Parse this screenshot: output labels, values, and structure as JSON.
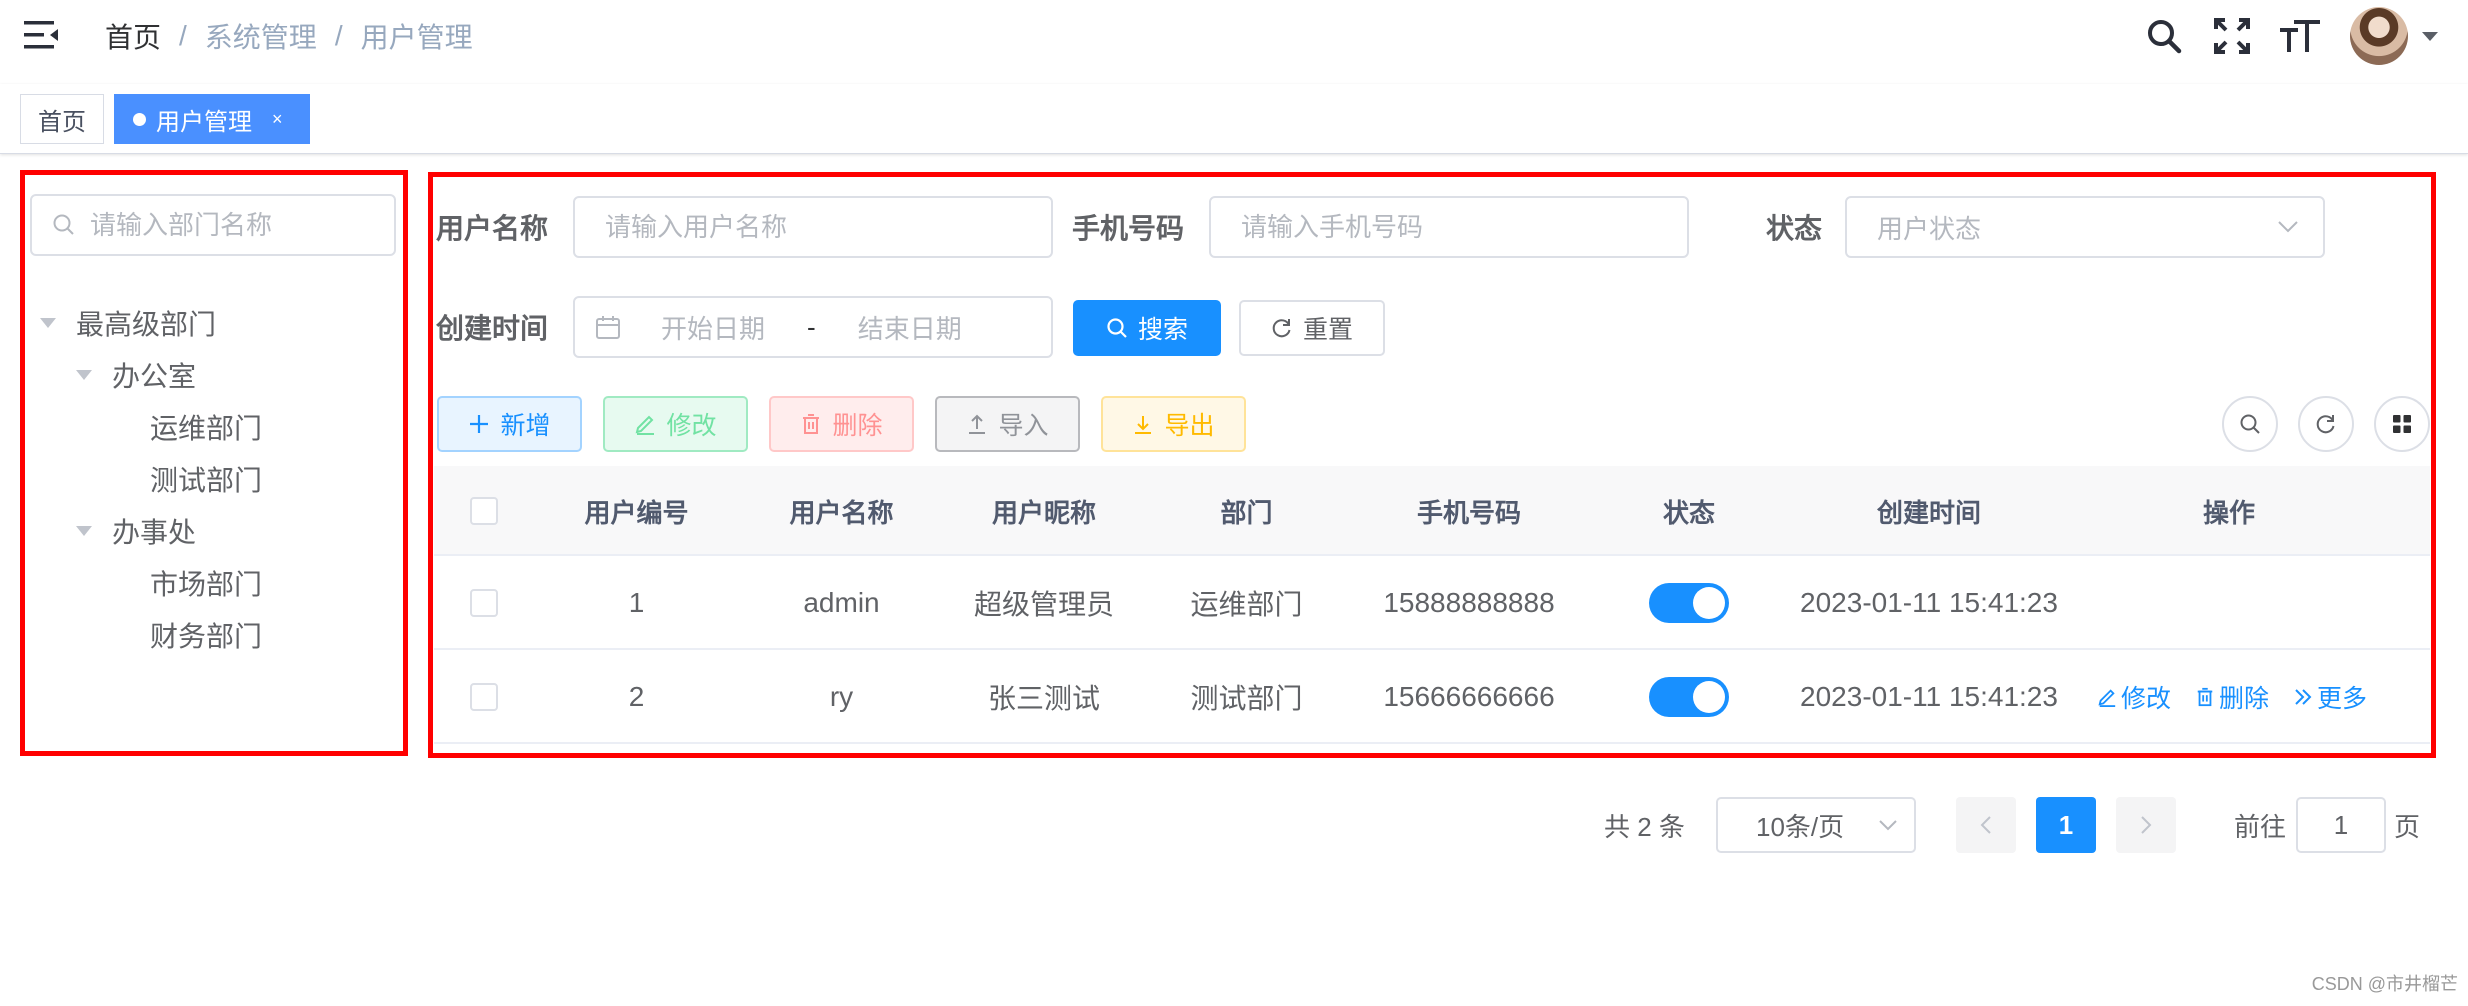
{
  "breadcrumb": {
    "home": "首页",
    "separator": "/",
    "items": [
      "系统管理",
      "用户管理"
    ]
  },
  "navbar": {
    "icons": [
      "search-icon",
      "fullscreen-icon",
      "font-size-icon"
    ],
    "avatar_alt": "avatar"
  },
  "tags": {
    "home": "首页",
    "active": "用户管理",
    "close": "×"
  },
  "dept_tree": {
    "search_placeholder": "请输入部门名称",
    "root": "最高级部门",
    "groups": [
      {
        "label": "办公室",
        "children": [
          "运维部门",
          "测试部门"
        ]
      },
      {
        "label": "办事处",
        "children": [
          "市场部门",
          "财务部门"
        ]
      }
    ]
  },
  "query": {
    "username_label": "用户名称",
    "username_placeholder": "请输入用户名称",
    "phone_label": "手机号码",
    "phone_placeholder": "请输入手机号码",
    "status_label": "状态",
    "status_placeholder": "用户状态",
    "created_label": "创建时间",
    "start_placeholder": "开始日期",
    "range_sep": "-",
    "end_placeholder": "结束日期",
    "search_button": "搜索",
    "reset_button": "重置"
  },
  "toolbar": {
    "add": "新增",
    "edit": "修改",
    "delete": "删除",
    "import": "导入",
    "export": "导出"
  },
  "table": {
    "headers": [
      "用户编号",
      "用户名称",
      "用户昵称",
      "部门",
      "手机号码",
      "状态",
      "创建时间",
      "操作"
    ],
    "rows": [
      {
        "id": "1",
        "username": "admin",
        "nickname": "超级管理员",
        "dept": "运维部门",
        "phone": "15888888888",
        "status_on": true,
        "created": "2023-01-11 15:41:23",
        "actions": []
      },
      {
        "id": "2",
        "username": "ry",
        "nickname": "张三测试",
        "dept": "测试部门",
        "phone": "15666666666",
        "status_on": true,
        "created": "2023-01-11 15:41:23",
        "actions": [
          "修改",
          "删除",
          "更多"
        ]
      }
    ]
  },
  "pagination": {
    "total_text": "共 2 条",
    "page_size": "10条/页",
    "current_page": "1",
    "goto_prefix": "前往",
    "goto_value": "1",
    "goto_suffix": "页"
  },
  "colors": {
    "primary": "#1890ff",
    "highlight_box": "#ff0000",
    "success": "#13ce66",
    "danger": "#ff4949",
    "warning": "#ffba00",
    "info": "#909399"
  },
  "watermark": "CSDN @市井榴芒"
}
